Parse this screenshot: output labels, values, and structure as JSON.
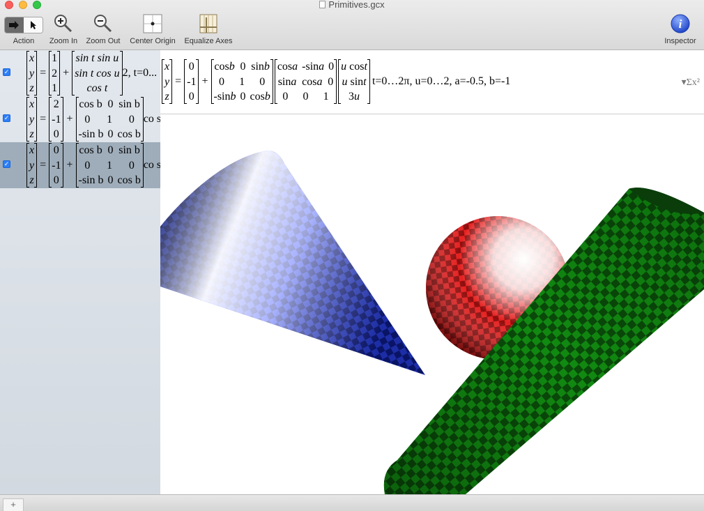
{
  "window": {
    "title": "Primitives.gcx"
  },
  "toolbar": {
    "action_label": "Action",
    "zoom_in_label": "Zoom In",
    "zoom_out_label": "Zoom Out",
    "center_origin_label": "Center Origin",
    "equalize_axes_label": "Equalize Axes",
    "inspector_label": "Inspector"
  },
  "equations": [
    {
      "checked": true,
      "selected": false,
      "offset": [
        "1",
        "2",
        "1"
      ],
      "rot_rows": [
        [
          "sin t sin u"
        ],
        [
          "sin t cos u"
        ],
        [
          "cos t"
        ]
      ],
      "tail": "2, t=0..."
    },
    {
      "checked": true,
      "selected": false,
      "offset": [
        "2",
        "-1",
        "0"
      ],
      "rot_rows": [
        [
          "cos b",
          "0",
          "sin b"
        ],
        [
          "0",
          "1",
          "0"
        ],
        [
          "-sin b",
          "0",
          "cos b"
        ]
      ],
      "tail": "co si ("
    },
    {
      "checked": true,
      "selected": true,
      "offset": [
        "0",
        "-1",
        "0"
      ],
      "rot_rows": [
        [
          "cos b",
          "0",
          "sin b"
        ],
        [
          "0",
          "1",
          "0"
        ],
        [
          "-sin b",
          "0",
          "cos b"
        ]
      ],
      "tail": "co si ("
    }
  ],
  "formula": {
    "offset": [
      "0",
      "-1",
      "0"
    ],
    "params": "t=0…2π, u=0…2, a=-0.5, b=-1",
    "sigma": "▾Σx²"
  },
  "colors": {
    "cone": "#1a2ee0",
    "sphere": "#e01818",
    "cylinder": "#0f8a0f",
    "accent": "#2d7ff9"
  },
  "icons": [
    "action-icon",
    "pointer-icon",
    "zoom-in-icon",
    "zoom-out-icon",
    "center-origin-icon",
    "equalize-axes-icon",
    "inspector-icon"
  ],
  "bottom": {
    "add_label": "+"
  }
}
